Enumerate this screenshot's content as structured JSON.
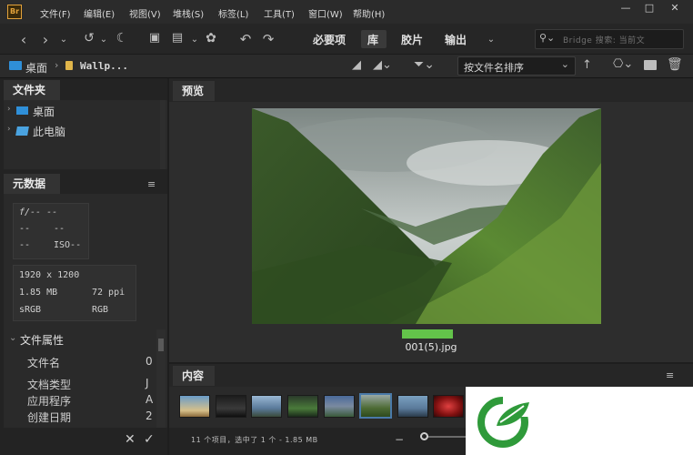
{
  "app": {
    "icon_label": "Br"
  },
  "menu": [
    "文件(F)",
    "编辑(E)",
    "视图(V)",
    "堆栈(S)",
    "标签(L)",
    "工具(T)",
    "窗口(W)",
    "帮助(H)"
  ],
  "window_controls": {
    "minimize": "—",
    "maximize": "□",
    "close": "✕"
  },
  "workspaces": [
    "必要项",
    "库",
    "胶片",
    "输出"
  ],
  "search": {
    "placeholder": "Bridge 搜索: 当前文"
  },
  "path": {
    "root": "桌面",
    "folder": "Wallp..."
  },
  "sort": {
    "label": "按文件名排序"
  },
  "folders_panel": {
    "title": "文件夹",
    "items": [
      "桌面",
      "此电脑"
    ]
  },
  "metadata_panel": {
    "title": "元数据",
    "exposure": {
      "fstop": "f/-- --",
      "row2a": "--",
      "row2b": "--",
      "row3a": "--",
      "iso": "ISO--"
    },
    "info": {
      "dimensions": "1920 x 1200",
      "size": "1.85 MB",
      "ppi": "72 ppi",
      "profile": "sRGB",
      "mode": "RGB"
    },
    "section_title": "文件属性",
    "properties": [
      {
        "label": "文件名",
        "value": "0"
      },
      {
        "label": "文档类型",
        "value": "J"
      },
      {
        "label": "应用程序",
        "value": "A"
      },
      {
        "label": "创建日期",
        "value": "2"
      }
    ]
  },
  "preview_panel": {
    "title": "预览",
    "filename": "001(5).jpg"
  },
  "content_panel": {
    "title": "内容",
    "status": "11 个项目，选中了 1 个 - 1.85 MB"
  },
  "footer_actions": {
    "reject": "✕",
    "accept": "✓"
  }
}
